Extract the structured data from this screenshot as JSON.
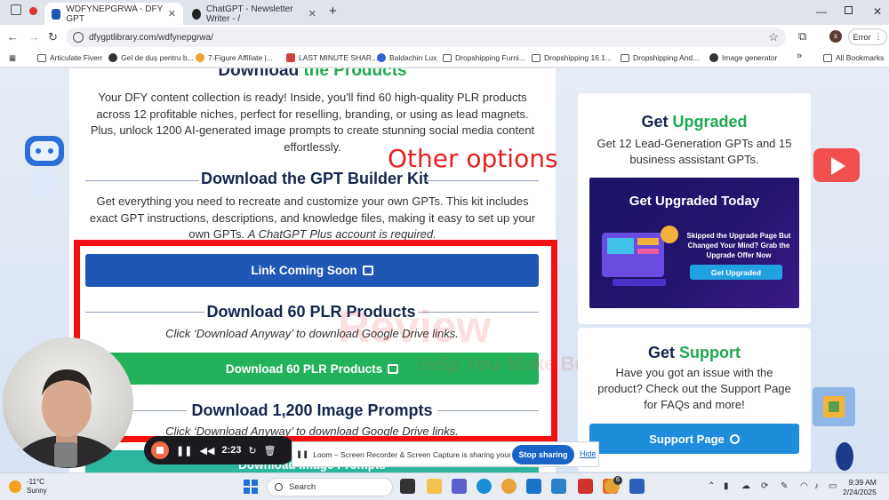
{
  "browser": {
    "tabs": [
      {
        "title": "WDFYNEPGRWA - DFY GPT",
        "active": true
      },
      {
        "title": "ChatGPT - Newsletter Writer - /",
        "active": false
      }
    ],
    "url": "dfygptlibrary.com/wdfynepgrwa/",
    "profile_initial": "s",
    "error_label": "Error",
    "bookmarks": [
      "Articulate Fiverr",
      "Gel de duș pentru b...",
      "7-Figure Affiliate |...",
      "LAST MINUTE SHAR...",
      "Baldachin Lux",
      "Dropshipping Furni...",
      "Dropshipping 16.1...",
      "Dropshipping And...",
      "Image generator"
    ],
    "more_bookmarks": "»",
    "all_bookmarks": "All Bookmarks"
  },
  "main": {
    "cut_heading_a": "Download",
    "cut_heading_b": "the Products",
    "intro": "Your DFY content collection is ready! Inside, you'll find 60 high-quality PLR products across 12 profitable niches, perfect for reselling, branding, or using as lead magnets. Plus, unlock 1200 AI-generated image prompts to create stunning social media content effortlessly.",
    "gpt_kit_heading": "Download the GPT Builder Kit",
    "gpt_kit_text": "Get everything you need to recreate and customize your own GPTs. This kit includes exact GPT instructions, descriptions, and knowledge files, making it easy to set up",
    "gpt_kit_text_tail": "your own GPTs.",
    "gpt_kit_text_note": "A ChatGPT Plus account is required.",
    "link_button": "Link Coming Soon",
    "plr_heading": "Download 60 PLR Products",
    "plr_sub": "Click ‘Download Anyway’ to download Google Drive links.",
    "plr_button": "Download 60 PLR Products",
    "prompts_heading": "Download 1,200 Image Prompts",
    "prompts_sub": "Click ‘Download Anyway’ to download Google Drive links.",
    "prompts_button_partial": "Download Image Prompts"
  },
  "annotation": {
    "other_options": "Other options"
  },
  "watermark": {
    "line1": "Review",
    "line2": "Help You Make Better Decisions"
  },
  "sidebar": {
    "upgrade_h_a": "Get",
    "upgrade_h_b": "Upgraded",
    "upgrade_text": "Get 12 Lead-Generation GPTs and 15 business assistant GPTs.",
    "promo_title": "Get Upgraded Today",
    "promo_text": "Skipped the Upgrade Page But Changed Your Mind? Grab the Upgrade Offer Now",
    "promo_button": "Get Upgraded",
    "support_h_a": "Get",
    "support_h_b": "Support",
    "support_text": "Have you got an issue with the product? Check out the Support Page for FAQs and more!",
    "support_button": "Support Page"
  },
  "loom": {
    "timer": "2:23",
    "share_text": "Loom – Screen Recorder & Screen Capture is sharing your screen.",
    "stop_label": "Stop sharing",
    "hide_label": "Hide"
  },
  "taskbar": {
    "temperature": "-11°C",
    "condition": "Sunny",
    "search_label": "Search",
    "time": "9:39 AM",
    "date": "2/24/2025",
    "notification_badge": "6"
  },
  "colors": {
    "accent_green": "#1fa84f",
    "button_blue": "#1e57b6",
    "button_green": "#22b35a",
    "annotation_red": "#f31010",
    "support_blue": "#1e8ddb"
  }
}
